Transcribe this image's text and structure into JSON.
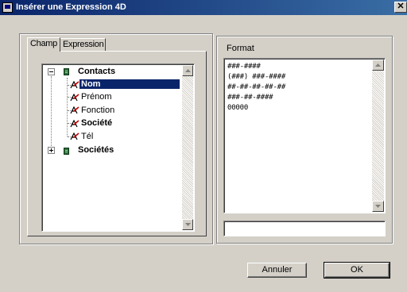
{
  "window": {
    "title": "Insérer une Expression 4D",
    "close_glyph": "✕"
  },
  "tabs": [
    {
      "label": "Champ"
    },
    {
      "label": "Expression"
    }
  ],
  "tree": {
    "tables": [
      {
        "name": "Contacts",
        "expanded": true,
        "fields": [
          "Nom",
          "Prénom",
          "Fonction",
          "Société",
          "Tél"
        ],
        "selected_field": "Nom"
      },
      {
        "name": "Sociétés",
        "expanded": false
      }
    ]
  },
  "format": {
    "label": "Format",
    "items": [
      "###-####",
      "(###) ###-####",
      "##-##-##-##-##",
      "###-##-####",
      "00000"
    ],
    "input_value": ""
  },
  "buttons": {
    "cancel": "Annuler",
    "ok": "OK"
  },
  "icons": {
    "window_icon": "app-window-icon",
    "table": "table-icon",
    "field": "field-icon",
    "expander_collapse": "minus-box-icon",
    "expander_expand": "plus-box-icon"
  },
  "colors": {
    "titlebar": "#0a246a",
    "selection": "#0a246a",
    "face": "#d4d0c8",
    "table_icon": "#2a6d3a"
  }
}
